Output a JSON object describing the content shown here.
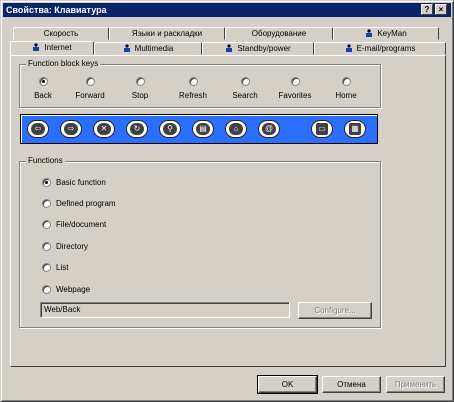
{
  "window": {
    "title": "Свойства: Клавиатура",
    "help_label": "?",
    "close_label": "×"
  },
  "tabs_back": [
    {
      "label": "Скорость"
    },
    {
      "label": "Языки и раскладки"
    },
    {
      "label": "Оборудование"
    },
    {
      "label": "KeyMan"
    }
  ],
  "tabs_front": [
    {
      "label": "Internet"
    },
    {
      "label": "Multimedia"
    },
    {
      "label": "Standby/power"
    },
    {
      "label": "E-mail/programs"
    }
  ],
  "function_block": {
    "title": "Function block keys",
    "keys": [
      {
        "label": "Back",
        "selected": true
      },
      {
        "label": "Forward"
      },
      {
        "label": "Stop"
      },
      {
        "label": "Refresh"
      },
      {
        "label": "Search"
      },
      {
        "label": "Favorites"
      },
      {
        "label": "Home"
      }
    ]
  },
  "keybar": {
    "color": "#2b6fff",
    "buttons": [
      {
        "icon": "back-arrow-icon",
        "glyph": "⇦"
      },
      {
        "icon": "forward-arrow-icon",
        "glyph": "⇨"
      },
      {
        "icon": "stop-icon",
        "glyph": "✕"
      },
      {
        "icon": "refresh-icon",
        "glyph": "↻"
      },
      {
        "icon": "search-icon",
        "glyph": "⚲"
      },
      {
        "icon": "favorites-icon",
        "glyph": "▤"
      },
      {
        "icon": "home-icon",
        "glyph": "⌂"
      },
      {
        "icon": "email-icon",
        "glyph": "@"
      },
      {
        "icon": "computer-icon",
        "glyph": "▭"
      },
      {
        "icon": "calculator-icon",
        "glyph": "▦"
      }
    ]
  },
  "functions": {
    "title": "Functions",
    "options": [
      {
        "label": "Basic function",
        "selected": true
      },
      {
        "label": "Defined program"
      },
      {
        "label": "File/document"
      },
      {
        "label": "Directory"
      },
      {
        "label": "List"
      },
      {
        "label": "Webpage"
      }
    ],
    "value": "Web/Back",
    "configure_label": "Configure..."
  },
  "footer": {
    "ok_label": "OK",
    "cancel_label": "Отмена",
    "apply_label": "Применить"
  }
}
